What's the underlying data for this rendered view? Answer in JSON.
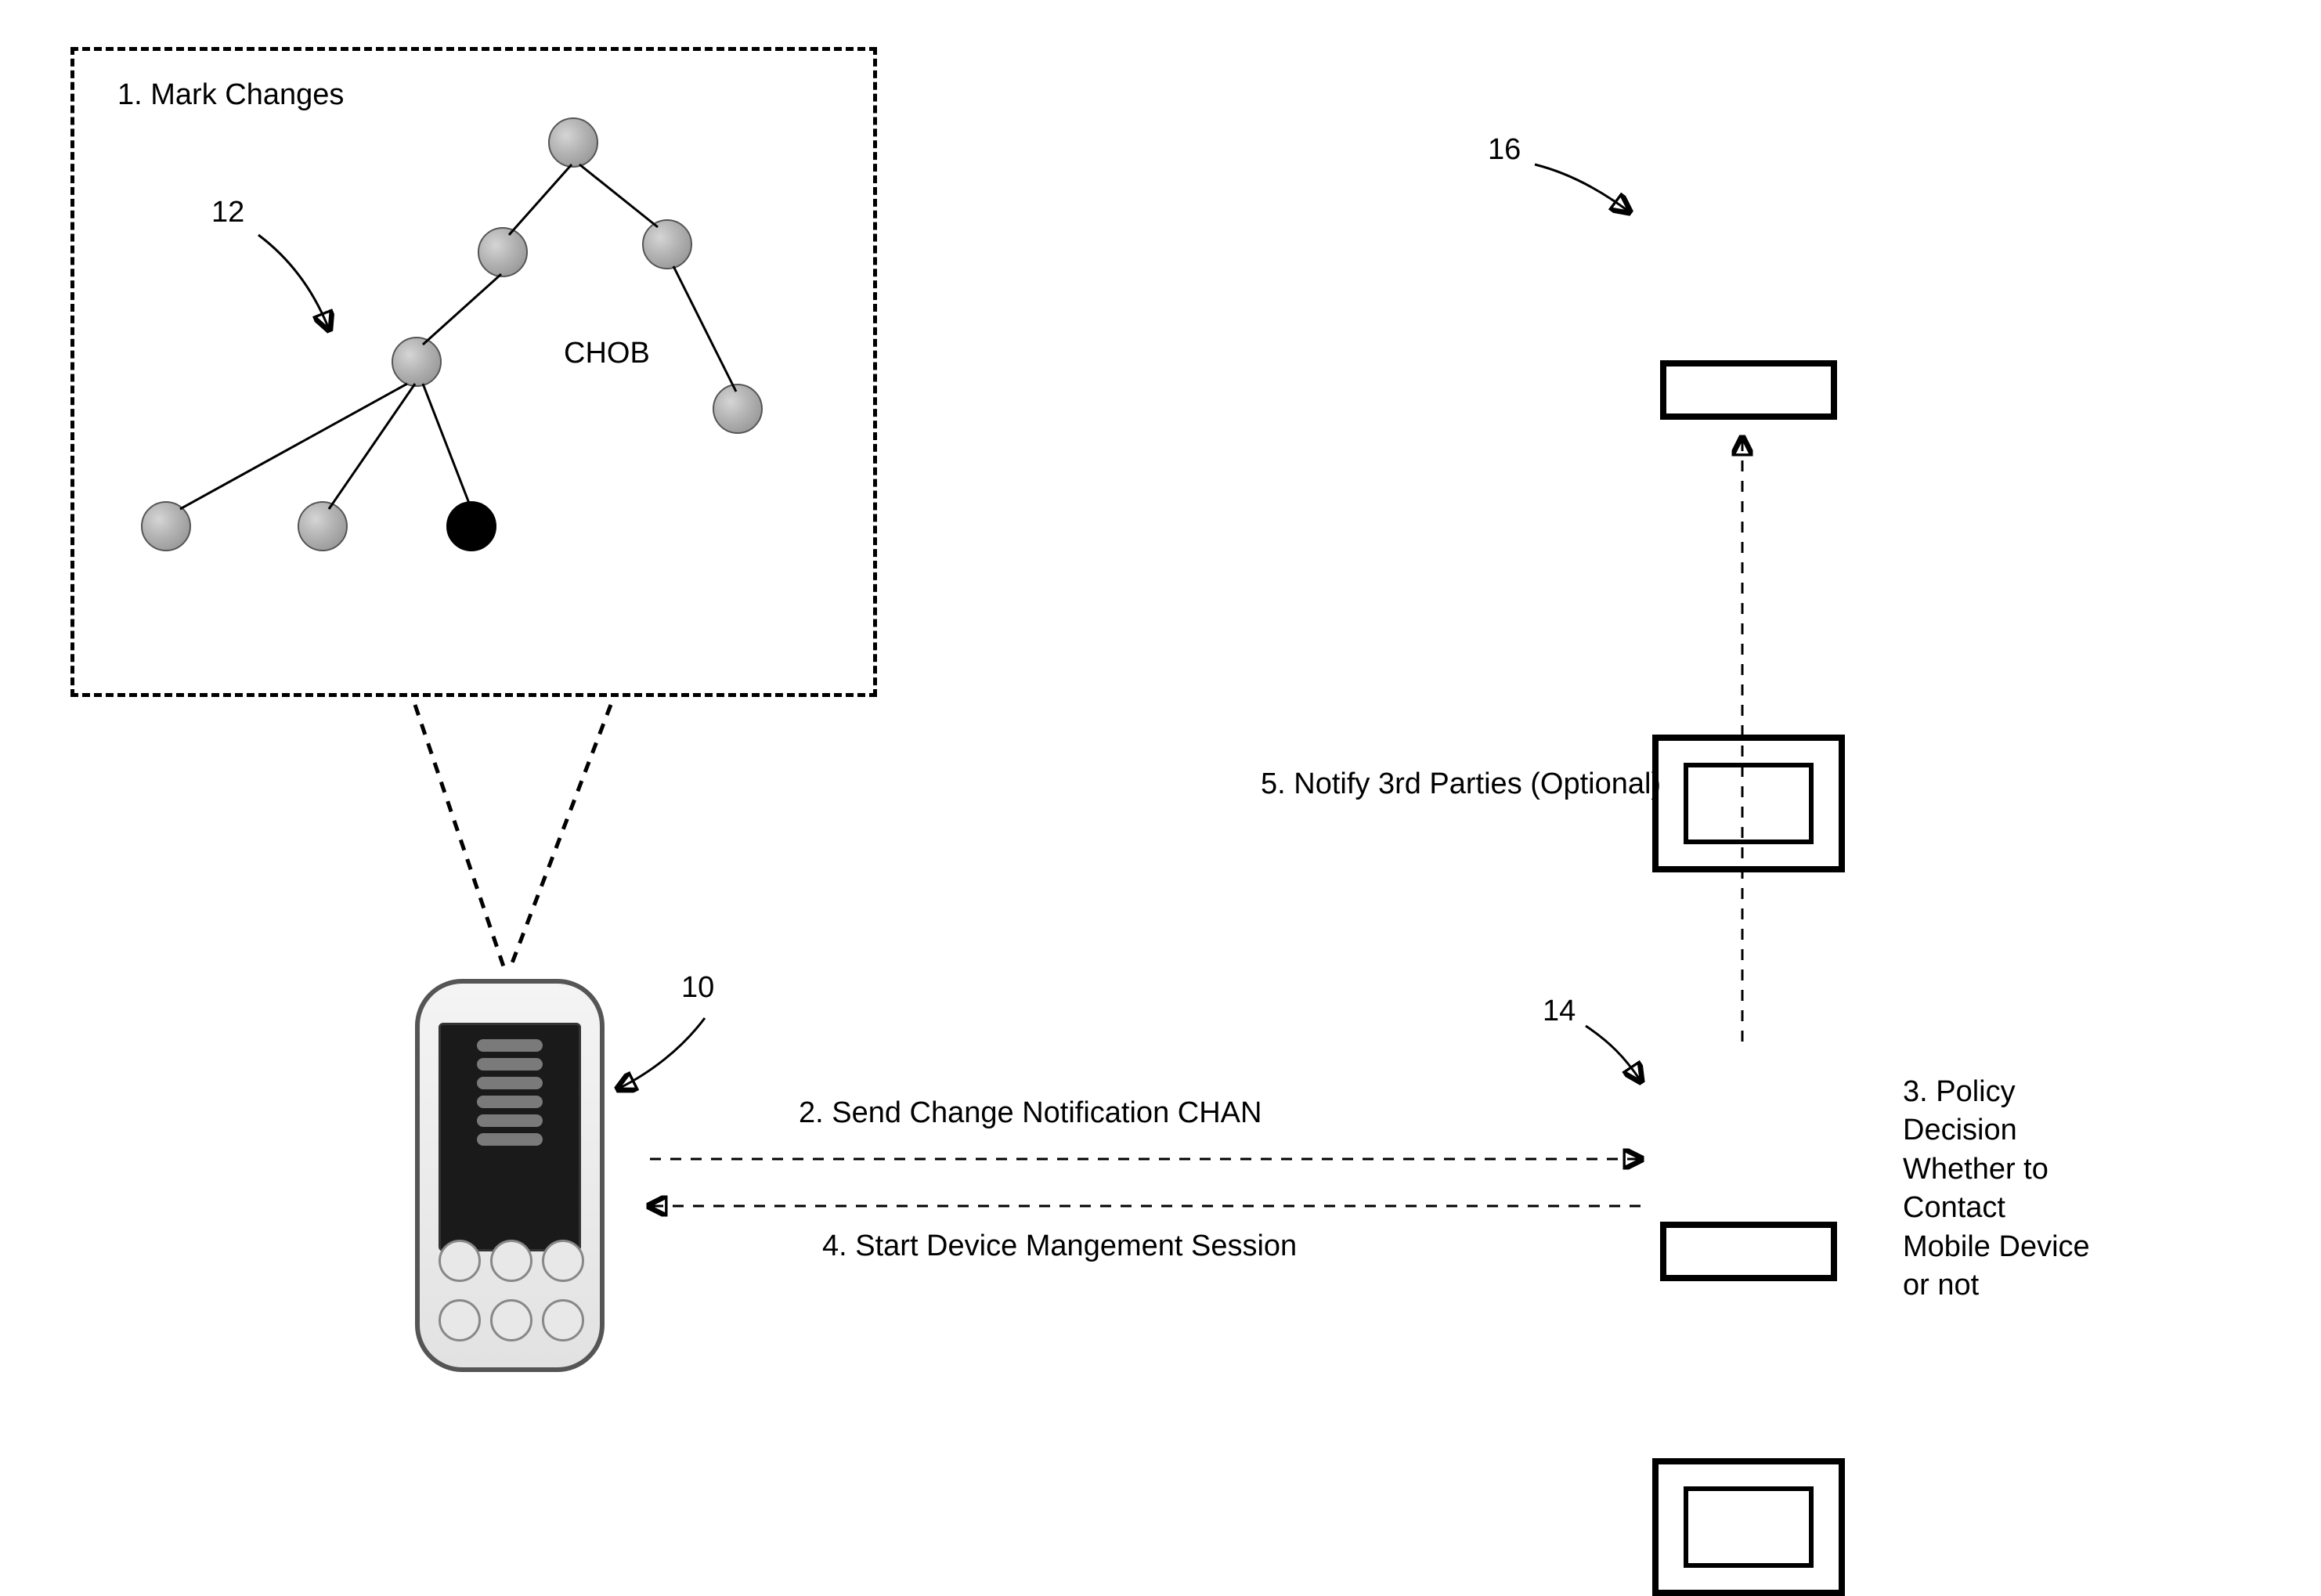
{
  "refs": {
    "phone": "10",
    "tree": "12",
    "server1": "14",
    "server2": "16"
  },
  "box_title": "1. Mark Changes",
  "tree_label": "CHOB",
  "steps": {
    "send": "2. Send Change Notification CHAN",
    "policy": "3. Policy\nDecision\nWhether to\nContact\nMobile Device\nor not",
    "start": "4. Start Device Mangement Session",
    "notify": "5. Notify 3rd Parties (Optional)"
  }
}
